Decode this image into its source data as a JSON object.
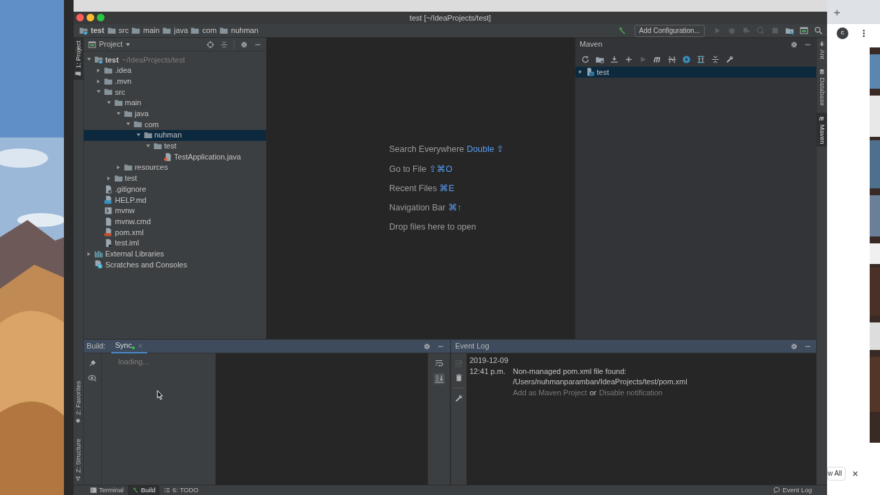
{
  "window": {
    "title": "test [~/IdeaProjects/test]"
  },
  "breadcrumbs": [
    {
      "label": "test",
      "kind": "module"
    },
    {
      "label": "src",
      "kind": "folder"
    },
    {
      "label": "main",
      "kind": "folder"
    },
    {
      "label": "java",
      "kind": "folder"
    },
    {
      "label": "com",
      "kind": "folder"
    },
    {
      "label": "nuhman",
      "kind": "folder"
    }
  ],
  "run_configuration": {
    "label": "Add Configuration..."
  },
  "left_stripe": [
    {
      "label": "1: Project",
      "selected": true
    },
    {
      "label": "2: Favorites",
      "selected": false
    },
    {
      "label": "Z: Structure",
      "selected": false
    }
  ],
  "right_stripe": [
    {
      "label": "Ant",
      "selected": false
    },
    {
      "label": "Database",
      "selected": false
    },
    {
      "label": "Maven",
      "selected": true
    }
  ],
  "project_panel": {
    "title": "Project",
    "tree": [
      {
        "label": "test",
        "path": "~/IdeaProjects/test",
        "kind": "module",
        "expanded": true,
        "selected": false,
        "children": [
          {
            "label": ".idea",
            "kind": "folder",
            "expanded": false,
            "selected": false
          },
          {
            "label": ".mvn",
            "kind": "folder",
            "expanded": false,
            "selected": false
          },
          {
            "label": "src",
            "kind": "folder",
            "expanded": true,
            "selected": false,
            "children": [
              {
                "label": "main",
                "kind": "folder",
                "expanded": true,
                "selected": false,
                "children": [
                  {
                    "label": "java",
                    "kind": "folder",
                    "expanded": true,
                    "selected": false,
                    "children": [
                      {
                        "label": "com",
                        "kind": "folder",
                        "expanded": true,
                        "selected": false,
                        "children": [
                          {
                            "label": "nuhman",
                            "kind": "folder",
                            "expanded": true,
                            "selected": true,
                            "children": [
                              {
                                "label": "test",
                                "kind": "folder",
                                "expanded": true,
                                "selected": false,
                                "children": [
                                  {
                                    "label": "TestApplication.java",
                                    "kind": "java",
                                    "selected": false
                                  }
                                ]
                              }
                            ]
                          }
                        ]
                      }
                    ]
                  },
                  {
                    "label": "resources",
                    "kind": "folder",
                    "expanded": false,
                    "selected": false
                  }
                ]
              },
              {
                "label": "test",
                "kind": "folder",
                "expanded": false,
                "selected": false
              }
            ]
          },
          {
            "label": ".gitignore",
            "kind": "ignore",
            "selected": false
          },
          {
            "label": "HELP.md",
            "kind": "markdown",
            "selected": false
          },
          {
            "label": "mvnw",
            "kind": "script",
            "selected": false
          },
          {
            "label": "mvnw.cmd",
            "kind": "file",
            "selected": false
          },
          {
            "label": "pom.xml",
            "kind": "pom",
            "selected": false
          },
          {
            "label": "test.iml",
            "kind": "iml",
            "selected": false
          }
        ]
      },
      {
        "label": "External Libraries",
        "kind": "libraries",
        "expanded": false,
        "selected": false
      },
      {
        "label": "Scratches and Consoles",
        "kind": "scratches",
        "selected": false
      }
    ]
  },
  "editor_hints": [
    {
      "action": "Search Everywhere",
      "shortcut": "Double ⇧"
    },
    {
      "action": "Go to File",
      "shortcut": "⇧⌘O"
    },
    {
      "action": "Recent Files",
      "shortcut": "⌘E"
    },
    {
      "action": "Navigation Bar",
      "shortcut": "⌘↑"
    },
    {
      "action": "Drop files here to open"
    }
  ],
  "maven_panel": {
    "title": "Maven",
    "tree": [
      {
        "label": "test",
        "expanded": false,
        "selected": true
      }
    ]
  },
  "build_panel": {
    "title": "Build:",
    "tabs": [
      {
        "label": "Sync",
        "selected": true
      }
    ],
    "status": "loading..."
  },
  "event_log": {
    "title": "Event Log",
    "date": "2019-12-09",
    "time": "12:41 p.m.",
    "message": "Non-managed pom.xml file found:",
    "path": "/Users/nuhmanparamban/IdeaProjects/test/pom.xml",
    "links": [
      "Add as Maven Project",
      "Disable notification"
    ],
    "joiner": "or"
  },
  "status_bar": {
    "tool_tabs": [
      {
        "label": "Terminal",
        "kind": "terminal",
        "selected": false
      },
      {
        "label": "Build",
        "kind": "build",
        "selected": true
      },
      {
        "label": "6: TODO",
        "kind": "todo",
        "selected": false
      }
    ],
    "event_log_button": "Event Log"
  },
  "browser": {
    "avatar": "c",
    "view_all": "w All"
  }
}
